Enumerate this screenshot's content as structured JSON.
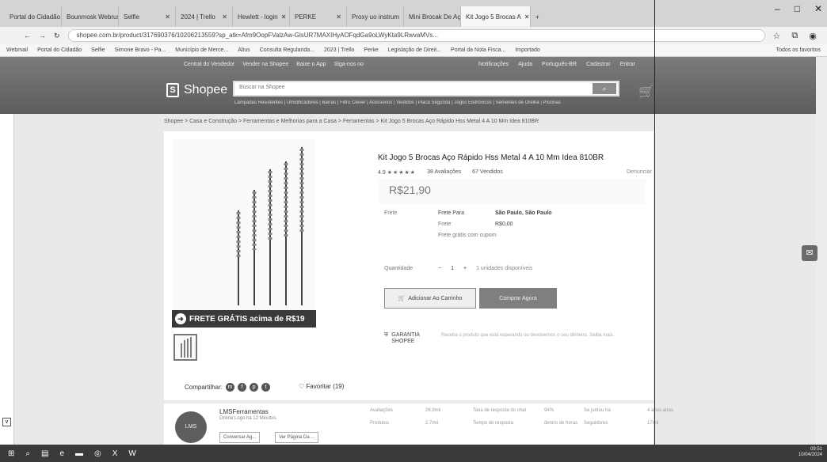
{
  "browser": {
    "tabs": [
      "Portal do Cidadão",
      "Bounmosk Webrus",
      "Selfie",
      "2024 | Trello",
      "Hewlett - login",
      "PERKE",
      "Proxy uo instrum",
      "Mini Brocak De Aço",
      "Kit Jogo 5 Brocas A"
    ],
    "url": "shopee.com.br/product/317690376/10206213559?sp_atk=Afm9OopFValzAw-GlsUR7MAXIHyAOFqdGa9oLWyKta9LRwvaMVs..."
  },
  "bookmarks": [
    "Webmail",
    "Portal do Cidadão",
    "Selfie",
    "Simone Bravo - Pa...",
    "Município de Merce...",
    "Altus",
    "Consulta Regularida...",
    "2023 | Trello",
    "Perke",
    "Legislação de Direit...",
    "Portal da Nota Fisca...",
    "Importado"
  ],
  "bookmarks_all": "Todos os favoritos",
  "shopee": {
    "topnav": [
      "Central do Vendedor",
      "Vender na Shopee",
      "Baixe o App",
      "Siga-nos no"
    ],
    "topnav_right": [
      "Notificações",
      "Ajuda",
      "Português-BR",
      "Cadastrar",
      "Entrar"
    ],
    "logo": "Shopee",
    "search_placeholder": "Buscar na Shopee",
    "suggestions": "Lâmpadas Resistentes | Umidificadores | Barras | Filtro Clever | Acessórios | Vestidos | Placa Segunda | Jogos Eletrônicos | Sementes de Orelha | Piscinas"
  },
  "breadcrumb": "Shopee > Casa e Construção > Ferramentas e Melhorias para a Casa > Ferramentas > Kit Jogo 5 Brocas Aço Rápido Hss Metal 4 A 10 Mm Idea 810BR",
  "product": {
    "title": "Kit Jogo 5 Brocas Aço Rápido Hss Metal 4 A 10 Mm Idea 810BR",
    "rating": "4.9",
    "stars": "★★★★★",
    "reviews_count": "38",
    "reviews_label": "Avaliações",
    "sold_count": "67",
    "sold_label": "Vendidos",
    "report": "Denunciar",
    "price": "R$21,90",
    "shipping_label": "Frete",
    "shipping_free": "Frete Para",
    "shipping_dest": "São Paulo, São Paulo",
    "shipping_cost_label": "Frete",
    "shipping_cost": "R$0,00",
    "shipping_note": "Frete grátis com cupom",
    "quantity_label": "Quantidade",
    "quantity_value": "1",
    "quantity_avail": "1 unidades disponíveis",
    "add_to_cart": "Adicionar Ao Carrinho",
    "buy_now": "Comprar Agora",
    "guarantee": "GARANTIA SHOPEE",
    "guarantee_text": "Receba o produto que está esperando ou devolvemos o seu dinheiro. Saiba mais.",
    "frete_banner": "FRETE GRÁTIS acima de R$19",
    "share_label": "Compartilhar:",
    "favorite": "Favoritar (19)"
  },
  "seller": {
    "name": "LMSFerramentas",
    "status": "Online Logo há 12 Minutos",
    "avatar_text": "LMS",
    "chat_btn": "Conversar Ag...",
    "shop_btn": "Ver Página Da ...",
    "stats": [
      "Avaliações",
      "26,9mil",
      "Taxa de resposta do chat",
      "94%",
      "Se juntou há",
      "4 anos atrás",
      "Produtos",
      "2,7mil",
      "Tempo de resposta",
      "dentro de horas",
      "Seguidores",
      "17mil"
    ]
  },
  "clock": {
    "time": "09:51",
    "date": "10/04/2024"
  }
}
